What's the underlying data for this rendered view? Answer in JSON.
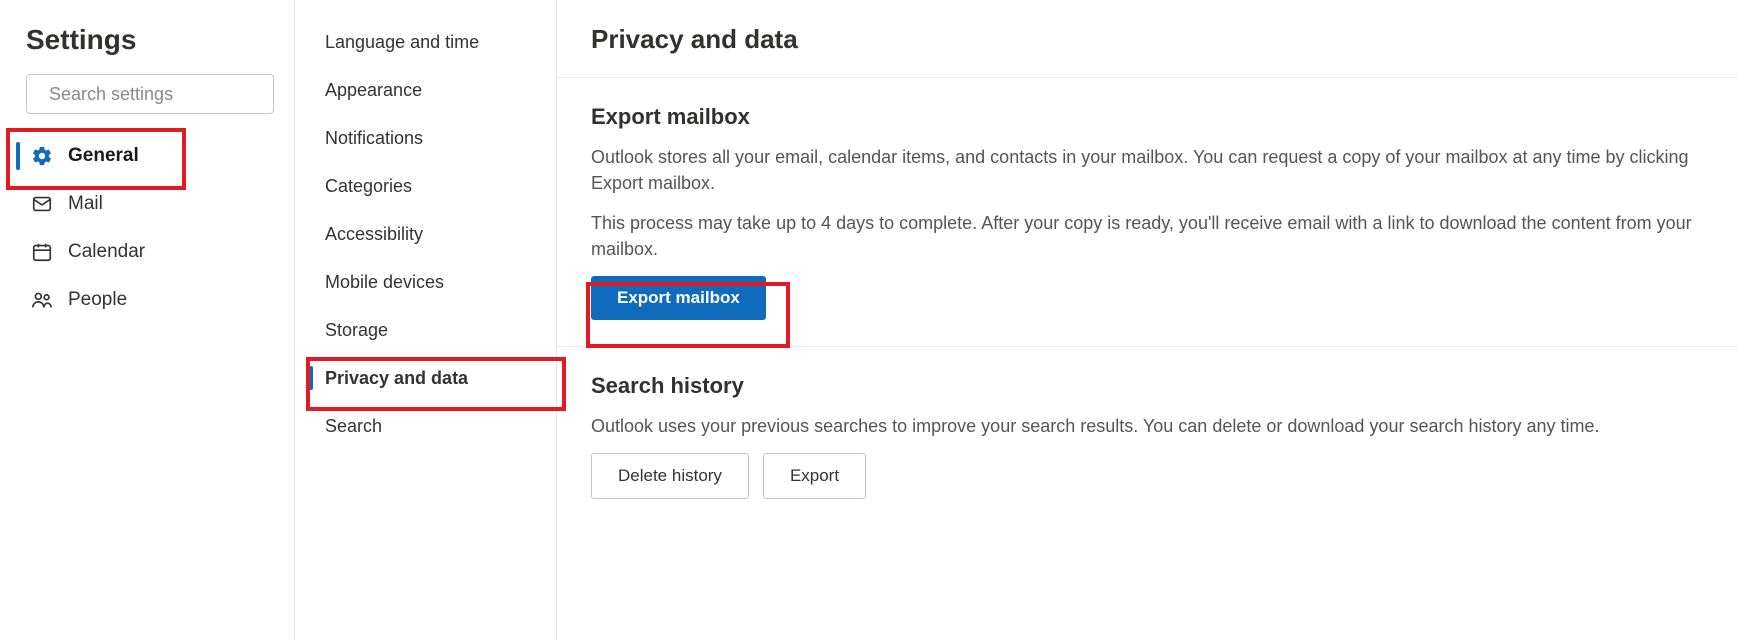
{
  "left": {
    "title": "Settings",
    "search_placeholder": "Search settings",
    "items": [
      {
        "label": "General",
        "icon": "gear",
        "active": true
      },
      {
        "label": "Mail",
        "icon": "mail",
        "active": false
      },
      {
        "label": "Calendar",
        "icon": "calendar",
        "active": false
      },
      {
        "label": "People",
        "icon": "people",
        "active": false
      }
    ]
  },
  "mid": {
    "items": [
      {
        "label": "Language and time",
        "active": false
      },
      {
        "label": "Appearance",
        "active": false
      },
      {
        "label": "Notifications",
        "active": false
      },
      {
        "label": "Categories",
        "active": false
      },
      {
        "label": "Accessibility",
        "active": false
      },
      {
        "label": "Mobile devices",
        "active": false
      },
      {
        "label": "Storage",
        "active": false
      },
      {
        "label": "Privacy and data",
        "active": true
      },
      {
        "label": "Search",
        "active": false
      }
    ]
  },
  "main": {
    "title": "Privacy and data",
    "sections": {
      "export": {
        "heading": "Export mailbox",
        "p1": "Outlook stores all your email, calendar items, and contacts in your mailbox. You can request a copy of your mailbox at any time by clicking Export mailbox.",
        "p2": "This process may take up to 4 days to complete. After your copy is ready, you'll receive email with a link to download the content from your mailbox.",
        "button": "Export mailbox"
      },
      "searchHistory": {
        "heading": "Search history",
        "p1": "Outlook uses your previous searches to improve your search results. You can delete or download your search history any time.",
        "delete_btn": "Delete history",
        "export_btn": "Export"
      }
    }
  }
}
